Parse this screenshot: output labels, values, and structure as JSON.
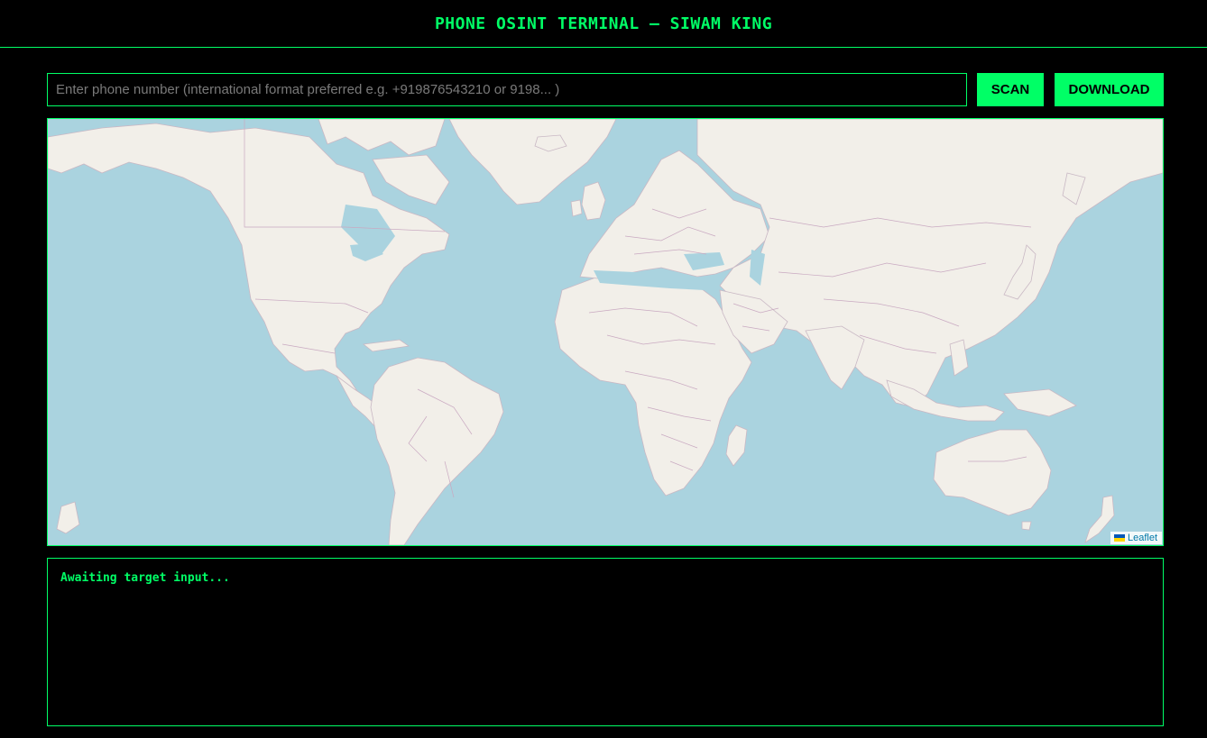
{
  "header": {
    "title": "PHONE OSINT TERMINAL — SIWAM KING"
  },
  "search": {
    "value": "",
    "placeholder": "Enter phone number (international format preferred e.g. +919876543210 or 9198... )"
  },
  "buttons": {
    "scan_label": "SCAN",
    "download_label": "DOWNLOAD"
  },
  "map": {
    "attribution_label": "Leaflet",
    "attribution_icon": "ukraine-flag-icon"
  },
  "console": {
    "output": "Awaiting target input..."
  },
  "colors": {
    "accent": "#00ff66",
    "background": "#000000",
    "water": "#aad3df",
    "land": "#f2efe9"
  }
}
